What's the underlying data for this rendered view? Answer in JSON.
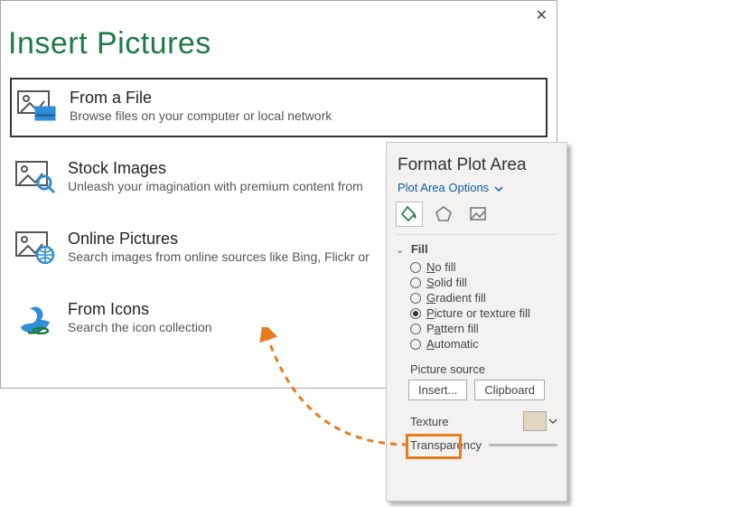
{
  "dialog": {
    "title": "Insert Pictures",
    "options": [
      {
        "title": "From a File",
        "desc": "Browse files on your computer or local network"
      },
      {
        "title": "Stock Images",
        "desc": "Unleash your imagination with premium content from"
      },
      {
        "title": "Online Pictures",
        "desc": "Search images from online sources like Bing, Flickr or"
      },
      {
        "title": "From Icons",
        "desc": "Search the icon collection"
      }
    ]
  },
  "pane": {
    "title": "Format Plot Area",
    "subtitle": "Plot Area Options",
    "section": "Fill",
    "radios": {
      "nofill": {
        "u": "N",
        "rest": "o fill"
      },
      "solid": {
        "u": "S",
        "rest": "olid fill"
      },
      "gradient": {
        "u": "G",
        "rest": "radient fill"
      },
      "picture": {
        "pre": "",
        "u": "P",
        "rest": "icture or texture fill"
      },
      "pattern": {
        "pre": "P",
        "u": "a",
        "rest": "ttern fill"
      },
      "auto": {
        "u": "A",
        "rest": "utomatic"
      }
    },
    "pictureSourceLabel": "Picture source",
    "insertBtn": "Insert...",
    "clipboardBtn": "Clipboard",
    "textureLabel": "Texture",
    "transparencyLabel": "Transparency"
  }
}
